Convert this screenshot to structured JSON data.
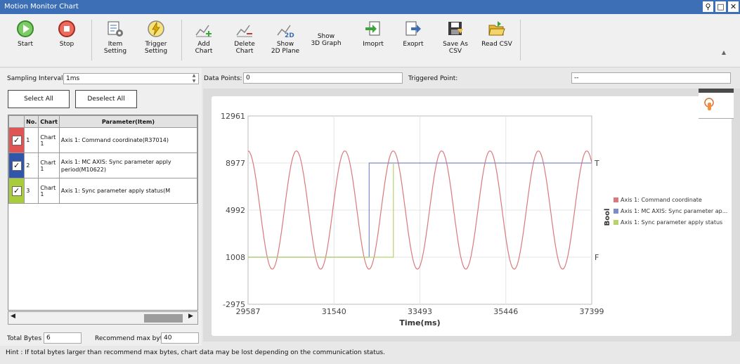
{
  "window": {
    "title": "Motion Monitor Chart"
  },
  "toolbar": {
    "start": "Start",
    "stop": "Stop",
    "item_setting_l1": "Item",
    "item_setting_l2": "Setting",
    "trigger_setting_l1": "Trigger",
    "trigger_setting_l2": "Setting",
    "add_chart_l1": "Add",
    "add_chart_l2": "Chart",
    "delete_chart_l1": "Delete",
    "delete_chart_l2": "Chart",
    "show_2d_l1": "Show",
    "show_2d_l2": "2D Plane",
    "show_3d_l1": "Show",
    "show_3d_l2": "3D Graph",
    "import": "Imoprt",
    "export": "Exoprt",
    "save_csv_l1": "Save As",
    "save_csv_l2": "CSV",
    "read_csv": "Read CSV"
  },
  "left": {
    "sampling_label": "Sampling Interval",
    "sampling_value": "1ms",
    "select_all": "Select All",
    "deselect_all": "Deselect All",
    "columns": [
      "No.",
      "Chart",
      "Parameter(Item)"
    ],
    "rows": [
      {
        "no": "1",
        "chart": "Chart 1",
        "param": "Axis 1: Command coordinate(R37014)",
        "color": "#e05454",
        "checked": "✓"
      },
      {
        "no": "2",
        "chart": "Chart 1",
        "param": "Axis 1: MC AXIS: Sync parameter apply period(M10622)",
        "color": "#2f56a8",
        "checked": "✓"
      },
      {
        "no": "3",
        "chart": "Chart 1",
        "param": "Axis 1: Sync parameter apply status(M",
        "color": "#a9cc3c",
        "checked": "✓"
      }
    ],
    "total_bytes_label": "Total Bytes",
    "total_bytes_value": "6",
    "recommend_label": "Recommend max bytes",
    "recommend_value": "40"
  },
  "top_info": {
    "data_points_label": "Data Points:",
    "data_points_value": "0",
    "triggered_label": "Triggered Point:",
    "triggered_value": "--"
  },
  "chart_data": {
    "type": "line",
    "xlabel": "Time(ms)",
    "y2label": "Bool",
    "xlim": [
      29587,
      37399
    ],
    "ylim": [
      -2975,
      12961
    ],
    "x_ticks": [
      "29587",
      "31540",
      "33493",
      "35446",
      "37399"
    ],
    "y_ticks": [
      "12961",
      "8977",
      "4992",
      "1008",
      "-2975"
    ],
    "y2_ticks": [
      "T",
      "F"
    ],
    "series": [
      {
        "name": "Axis 1: Command coordinate",
        "color": "#d9797e",
        "kind": "sine",
        "amplitude": 5000,
        "center": 5000,
        "period": 1100,
        "phase_x": 29587,
        "phase_value": 9500
      },
      {
        "name": "Axis 1: MC AXIS: Sync parameter ap...",
        "color": "#7e8cc4",
        "kind": "step",
        "x": [
          29587,
          32340,
          32340,
          32487,
          37399
        ],
        "y": [
          "F",
          "F",
          "T",
          "T",
          "T"
        ]
      },
      {
        "name": "Axis 1: Sync parameter apply status",
        "color": "#b9d26a",
        "kind": "step",
        "x": [
          29587,
          32890,
          32890,
          32890
        ],
        "y": [
          "F",
          "F",
          "T",
          "F"
        ]
      }
    ]
  },
  "hint": "Hint : If total bytes larger than recommend max bytes, chart data may be lost depending on the communication status."
}
